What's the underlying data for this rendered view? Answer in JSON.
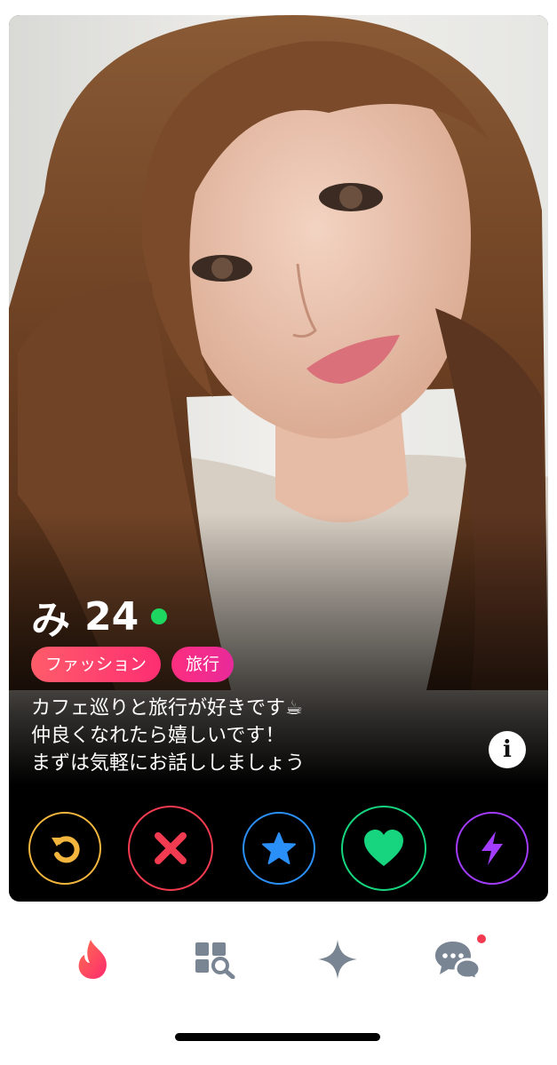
{
  "profile": {
    "name": "み",
    "age": "24",
    "online_color": "#1ed760",
    "tags": [
      "ファッション",
      "旅行"
    ],
    "bio": [
      "カフェ巡りと旅行が好きです☕",
      "仲良くなれたら嬉しいです！",
      "まずは気軽にお話ししましょう"
    ],
    "info_icon": "i"
  },
  "actions": [
    {
      "name": "rewind",
      "icon": "rewind-arrow-icon",
      "color": "#f2b53d"
    },
    {
      "name": "nope",
      "icon": "x-icon",
      "color": "#f23b50"
    },
    {
      "name": "super-like",
      "icon": "star-icon",
      "color": "#2a8ff7"
    },
    {
      "name": "like",
      "icon": "heart-icon",
      "color": "#16d57e"
    },
    {
      "name": "boost",
      "icon": "lightning-bolt-icon",
      "color": "#a23cff"
    }
  ],
  "tabs": [
    {
      "name": "swipe",
      "icon": "flame-icon",
      "active": true
    },
    {
      "name": "explore",
      "icon": "grid-search-icon",
      "active": false
    },
    {
      "name": "gold",
      "icon": "sparkle-icon",
      "active": false
    },
    {
      "name": "chats",
      "icon": "chat-bubbles-icon",
      "active": false,
      "badge": true
    }
  ]
}
